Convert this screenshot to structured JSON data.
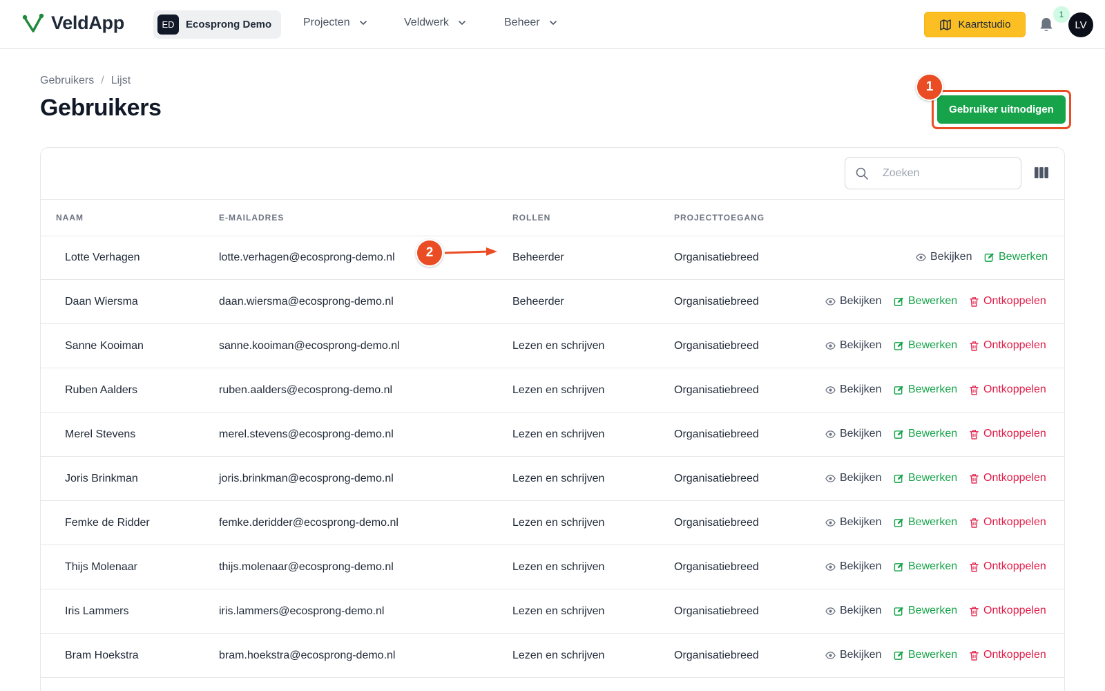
{
  "app": {
    "name": "VeldApp"
  },
  "org": {
    "initials": "ED",
    "name": "Ecosprong Demo"
  },
  "nav": [
    {
      "label": "Projecten"
    },
    {
      "label": "Veldwerk"
    },
    {
      "label": "Beheer"
    }
  ],
  "header_actions": {
    "kaartstudio_label": "Kaartstudio",
    "notification_count": "1",
    "user_initials": "LV"
  },
  "breadcrumb": {
    "root": "Gebruikers",
    "sep": "/",
    "current": "Lijst"
  },
  "page": {
    "title": "Gebruikers",
    "invite_label": "Gebruiker uitnodigen"
  },
  "annotations": {
    "marker_1": "1",
    "marker_2": "2"
  },
  "search": {
    "placeholder": "Zoeken"
  },
  "table": {
    "headers": {
      "name": "NAAM",
      "email": "E-MAILADRES",
      "roles": "ROLLEN",
      "access": "PROJECTTOEGANG"
    },
    "actions": {
      "view": "Bekijken",
      "edit": "Bewerken",
      "unlink": "Ontkoppelen"
    },
    "rows": [
      {
        "name": "Lotte Verhagen",
        "email": "lotte.verhagen@ecosprong-demo.nl",
        "role": "Beheerder",
        "access": "Organisatiebreed"
      },
      {
        "name": "Daan Wiersma",
        "email": "daan.wiersma@ecosprong-demo.nl",
        "role": "Beheerder",
        "access": "Organisatiebreed"
      },
      {
        "name": "Sanne Kooiman",
        "email": "sanne.kooiman@ecosprong-demo.nl",
        "role": "Lezen en schrijven",
        "access": "Organisatiebreed"
      },
      {
        "name": "Ruben Aalders",
        "email": "ruben.aalders@ecosprong-demo.nl",
        "role": "Lezen en schrijven",
        "access": "Organisatiebreed"
      },
      {
        "name": "Merel Stevens",
        "email": "merel.stevens@ecosprong-demo.nl",
        "role": "Lezen en schrijven",
        "access": "Organisatiebreed"
      },
      {
        "name": "Joris Brinkman",
        "email": "joris.brinkman@ecosprong-demo.nl",
        "role": "Lezen en schrijven",
        "access": "Organisatiebreed"
      },
      {
        "name": "Femke de Ridder",
        "email": "femke.deridder@ecosprong-demo.nl",
        "role": "Lezen en schrijven",
        "access": "Organisatiebreed"
      },
      {
        "name": "Thijs Molenaar",
        "email": "thijs.molenaar@ecosprong-demo.nl",
        "role": "Lezen en schrijven",
        "access": "Organisatiebreed"
      },
      {
        "name": "Iris Lammers",
        "email": "iris.lammers@ecosprong-demo.nl",
        "role": "Lezen en schrijven",
        "access": "Organisatiebreed"
      },
      {
        "name": "Bram Hoekstra",
        "email": "bram.hoekstra@ecosprong-demo.nl",
        "role": "Lezen en schrijven",
        "access": "Organisatiebreed"
      }
    ]
  },
  "colors": {
    "brand_green": "#16a34a",
    "accent_yellow": "#fbbf24",
    "danger": "#e11d48",
    "annotation": "#ea4d23"
  }
}
